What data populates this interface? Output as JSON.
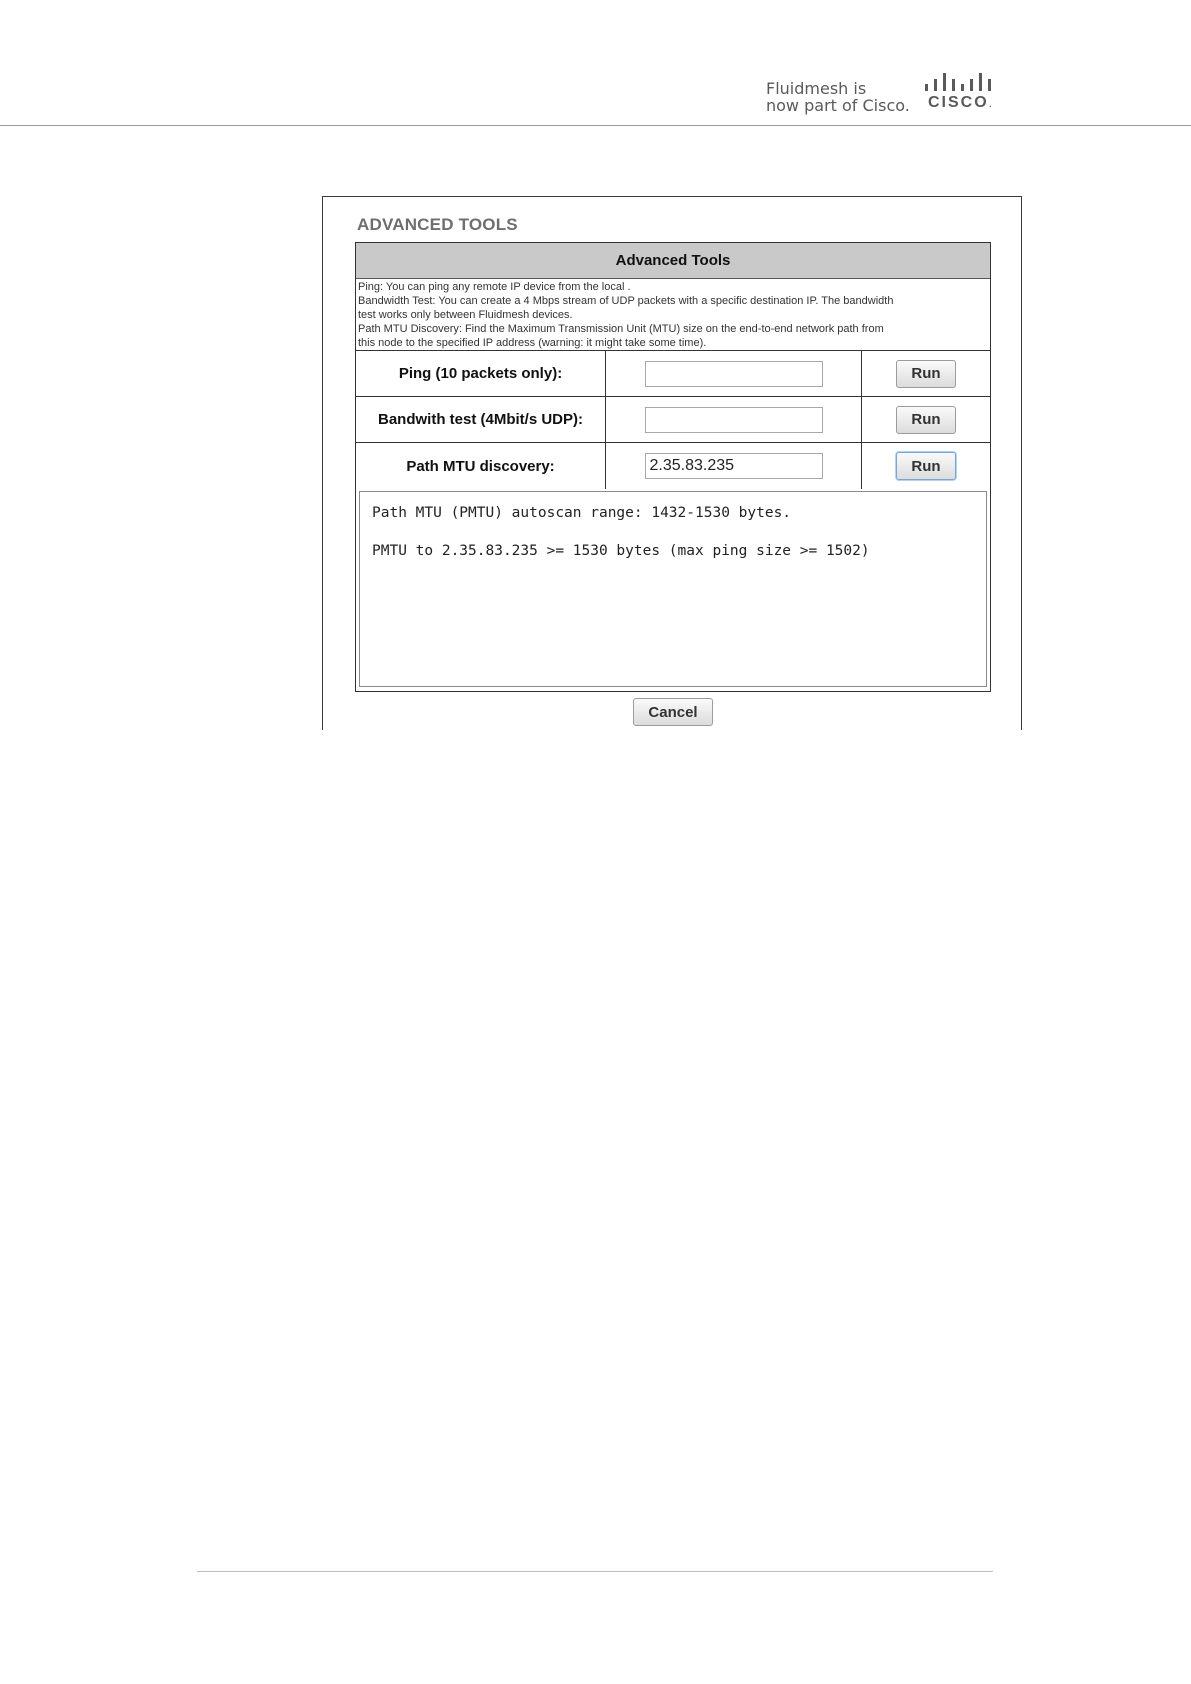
{
  "header": {
    "brand_line1": "Fluidmesh is",
    "brand_line2": "now part of Cisco.",
    "logo_word": "CISCO",
    "logo_dot": "."
  },
  "section": {
    "title": "ADVANCED TOOLS"
  },
  "panel": {
    "header": "Advanced Tools",
    "description": [
      "Ping: You can ping any remote IP device from the local .",
      "Bandwidth Test: You can create a 4 Mbps stream of UDP packets with a specific destination IP. The bandwidth",
      "test works only between Fluidmesh devices.",
      "Path MTU Discovery: Find the Maximum Transmission Unit (MTU) size on the end-to-end network path from",
      "this node to the specified IP address (warning: it might take some time)."
    ],
    "rows": [
      {
        "label": "Ping (10 packets only):",
        "value": "",
        "button": "Run"
      },
      {
        "label": "Bandwith test (4Mbit/s UDP):",
        "value": "",
        "button": "Run"
      },
      {
        "label": "Path MTU discovery:",
        "value": "2.35.83.235",
        "button": "Run"
      }
    ],
    "output_lines": [
      "Path MTU (PMTU) autoscan range: 1432-1530 bytes.",
      "PMTU to 2.35.83.235 >= 1530 bytes (max ping size >= 1502)"
    ],
    "cancel_label": "Cancel"
  },
  "colors": {
    "panel_header_bg": "#c9c9c9",
    "section_title": "#6e6e6e",
    "focus_border": "#7aa3d6"
  }
}
